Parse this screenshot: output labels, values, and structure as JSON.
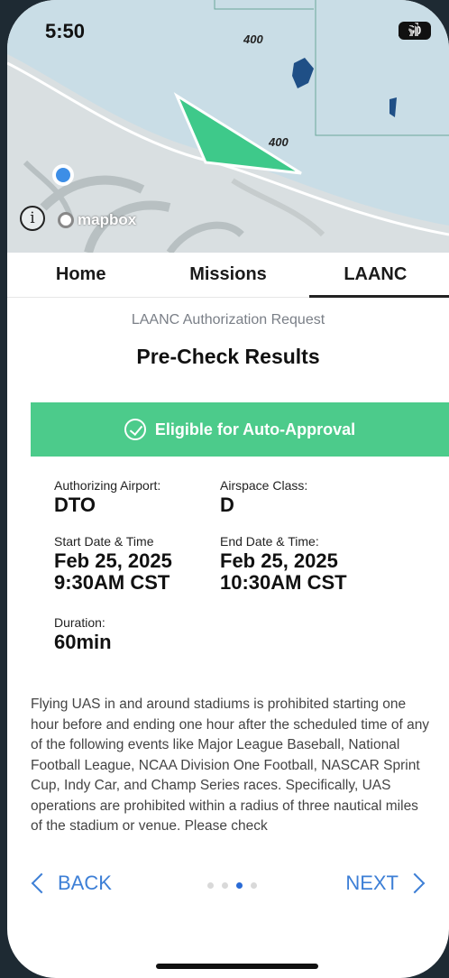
{
  "status": {
    "time": "5:50",
    "battery": "50"
  },
  "map": {
    "altitude_labels": [
      "400",
      "400"
    ],
    "attribution": "mapbox",
    "info_symbol": "i",
    "colors": {
      "water": "#c9dde6",
      "zone": "#3ec98a",
      "land": "#d9dfe1"
    }
  },
  "tabs": [
    {
      "label": "Home",
      "active": false
    },
    {
      "label": "Missions",
      "active": false
    },
    {
      "label": "LAANC",
      "active": true
    }
  ],
  "header": {
    "subtitle": "LAANC Authorization Request",
    "title": "Pre-Check Results"
  },
  "banner": {
    "text": "Eligible for Auto-Approval",
    "icon": "check-circle-icon",
    "color": "#4ccb8b"
  },
  "details": {
    "airport_label": "Authorizing Airport:",
    "airport_value": "DTO",
    "class_label": "Airspace Class:",
    "class_value": "D",
    "start_label": "Start Date & Time",
    "start_date": "Feb 25, 2025",
    "start_time": "9:30AM CST",
    "end_label": "End Date & Time:",
    "end_date": "Feb 25, 2025",
    "end_time": "10:30AM CST",
    "duration_label": "Duration:",
    "duration_value": "60min"
  },
  "description": "Flying UAS in and around stadiums is prohibited starting one hour before and ending one hour after the scheduled time of any of the following events like Major League Baseball, National Football League, NCAA Division One Football, NASCAR Sprint Cup, Indy Car, and Champ Series races. Specifically, UAS operations are prohibited within a radius of three nautical miles of the stadium or venue. Please check",
  "nav": {
    "back": "BACK",
    "next": "NEXT",
    "page_count": 4,
    "current_page": 3,
    "accent": "#3d7fd6"
  }
}
